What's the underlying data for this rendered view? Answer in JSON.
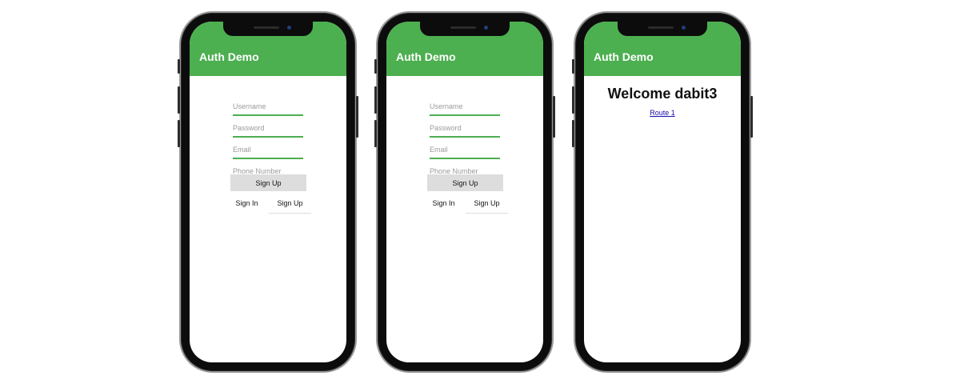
{
  "app": {
    "title": "Auth Demo"
  },
  "colors": {
    "header": "#4caf50",
    "field_underline": "#4caf50",
    "button_bg": "#dddddd"
  },
  "phones": [
    {
      "fields": [
        {
          "placeholder": "Username"
        },
        {
          "placeholder": "Password"
        },
        {
          "placeholder": "Email"
        },
        {
          "placeholder": "Phone Number"
        }
      ],
      "submit_label": "Sign Up",
      "tabs": [
        "Sign In",
        "Sign Up"
      ]
    },
    {
      "fields": [
        {
          "placeholder": "Username"
        },
        {
          "placeholder": "Password"
        },
        {
          "placeholder": "Email"
        },
        {
          "placeholder": "Phone Number"
        }
      ],
      "submit_label": "Sign Up",
      "tabs": [
        "Sign In",
        "Sign Up"
      ]
    },
    {
      "welcome": "Welcome dabit3",
      "link": "Route 1"
    }
  ]
}
